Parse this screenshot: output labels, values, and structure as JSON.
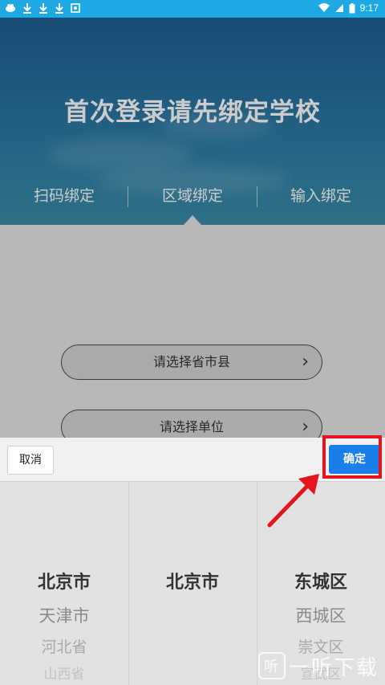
{
  "status_bar": {
    "time": "9:17"
  },
  "header": {
    "title": "首次登录请先绑定学校",
    "tabs": [
      {
        "label": "扫码绑定"
      },
      {
        "label": "区域绑定"
      },
      {
        "label": "输入绑定"
      }
    ]
  },
  "form": {
    "province_select": {
      "label": "请选择省市县",
      "icon": "chevron-right-icon"
    },
    "unit_select": {
      "label": "请选择单位",
      "icon": "chevron-right-icon"
    }
  },
  "picker": {
    "cancel_label": "取消",
    "confirm_label": "确定",
    "columns": [
      {
        "items": [
          "北京市",
          "天津市",
          "河北省",
          "山西省"
        ],
        "selected": "北京市"
      },
      {
        "items": [
          "北京市"
        ],
        "selected": "北京市"
      },
      {
        "items": [
          "东城区",
          "西城区",
          "崇文区",
          "宣武区"
        ],
        "selected": "东城区"
      }
    ]
  },
  "watermark": {
    "text": "一听下载",
    "glyph": "听"
  },
  "colors": {
    "accent": "#1a7fea",
    "highlight": "#e5151d",
    "status_bar": "#1ea9e4"
  }
}
